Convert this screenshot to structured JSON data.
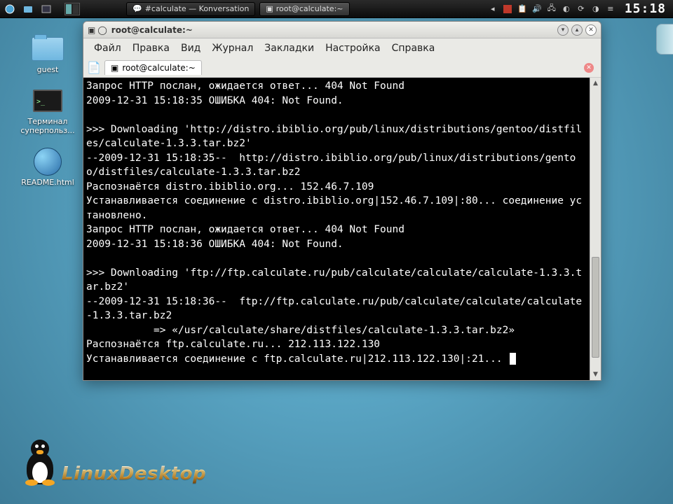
{
  "panel": {
    "task1": "#calculate — Konversation",
    "task2": "root@calculate:~",
    "clock": "15:18"
  },
  "desktop": {
    "icon1": "guest",
    "icon2": "Терминал суперпольз...",
    "icon3": "README.html"
  },
  "window": {
    "title": "root@calculate:~",
    "menu": {
      "file": "Файл",
      "edit": "Правка",
      "view": "Вид",
      "journal": "Журнал",
      "bookmarks": "Закладки",
      "settings": "Настройка",
      "help": "Справка"
    },
    "tab": "root@calculate:~"
  },
  "terminal": {
    "lines": "Запрос HTTP послан, ожидается ответ... 404 Not Found\n2009-12-31 15:18:35 ОШИБКА 404: Not Found.\n\n>>> Downloading 'http://distro.ibiblio.org/pub/linux/distributions/gentoo/distfiles/calculate-1.3.3.tar.bz2'\n--2009-12-31 15:18:35--  http://distro.ibiblio.org/pub/linux/distributions/gentoo/distfiles/calculate-1.3.3.tar.bz2\nРаспознаётся distro.ibiblio.org... 152.46.7.109\nУстанавливается соединение с distro.ibiblio.org|152.46.7.109|:80... соединение установлено.\nЗапрос HTTP послан, ожидается ответ... 404 Not Found\n2009-12-31 15:18:36 ОШИБКА 404: Not Found.\n\n>>> Downloading 'ftp://ftp.calculate.ru/pub/calculate/calculate/calculate-1.3.3.tar.bz2'\n--2009-12-31 15:18:36--  ftp://ftp.calculate.ru/pub/calculate/calculate/calculate-1.3.3.tar.bz2\n           => «/usr/calculate/share/distfiles/calculate-1.3.3.tar.bz2»\nРаспознаётся ftp.calculate.ru... 212.113.122.130\nУстанавливается соединение с ftp.calculate.ru|212.113.122.130|:21... "
  },
  "brand": "LinuxDesktop"
}
